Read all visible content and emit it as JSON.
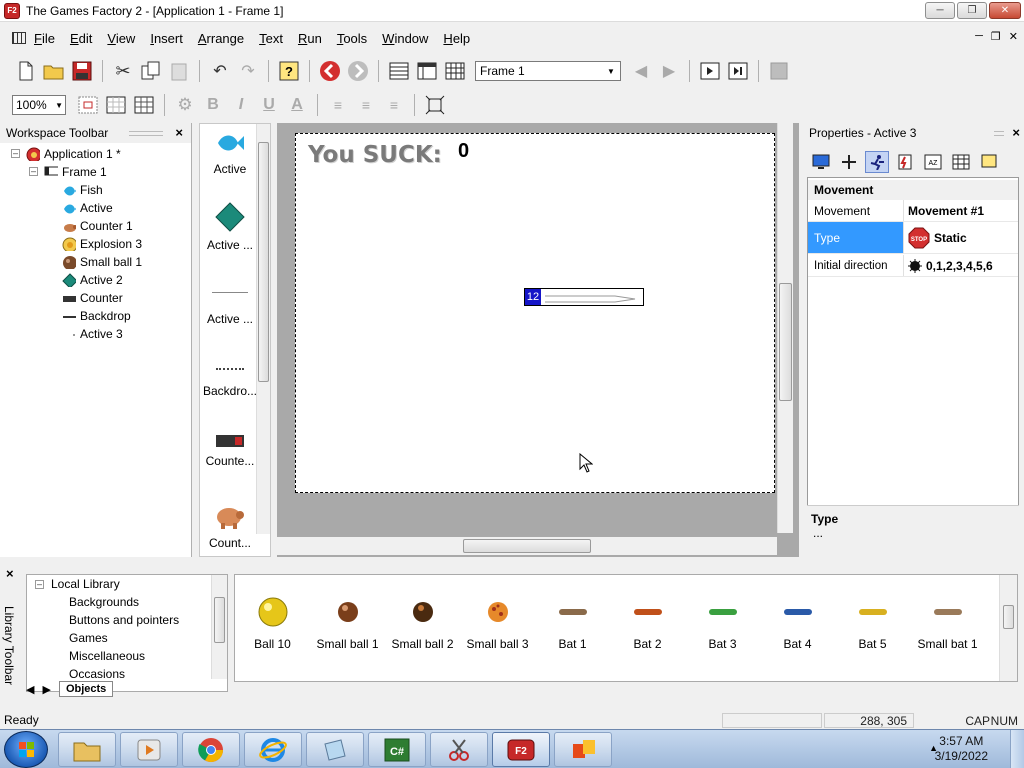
{
  "window": {
    "title": "The Games Factory 2 - [Application 1 - Frame 1]",
    "min_icon": "minimize-icon",
    "max_icon": "maximize-icon",
    "close_icon": "close-icon"
  },
  "menu": {
    "items": [
      {
        "label": "File",
        "underline": "F"
      },
      {
        "label": "Edit",
        "underline": "E"
      },
      {
        "label": "View",
        "underline": "V"
      },
      {
        "label": "Insert",
        "underline": "I"
      },
      {
        "label": "Arrange",
        "underline": "A"
      },
      {
        "label": "Text",
        "underline": "T"
      },
      {
        "label": "Run",
        "underline": "R"
      },
      {
        "label": "Tools",
        "underline": "T"
      },
      {
        "label": "Window",
        "underline": "W"
      },
      {
        "label": "Help",
        "underline": "H"
      }
    ]
  },
  "toolbar": {
    "frame_select": "Frame 1",
    "zoom_select": "100%"
  },
  "workspace": {
    "title": "Workspace Toolbar",
    "tree": {
      "app": "Application 1 *",
      "frame": "Frame 1",
      "objects": [
        "Fish",
        "Active",
        "Counter 1",
        "Explosion 3",
        "Small ball 1",
        "Active 2",
        "Counter",
        "Backdrop",
        "Active 3"
      ]
    }
  },
  "shelf": {
    "items": [
      "Active",
      "Active ...",
      "Active ...",
      "Backdro...",
      "Counte...",
      "Count..."
    ]
  },
  "frame": {
    "text_label": "You SUCK:",
    "counter_value": "0",
    "selected_object_number": "12"
  },
  "properties": {
    "title": "Properties - Active 3",
    "category": "Movement",
    "rows": [
      {
        "key": "Movement",
        "value": "Movement #1"
      },
      {
        "key": "Type",
        "value": "Static"
      },
      {
        "key": "Initial direction",
        "value": "0,1,2,3,4,5,6"
      }
    ],
    "help_title": "Type",
    "help_text": "..."
  },
  "library": {
    "side_label": "Library Toolbar",
    "tree": {
      "root": "Local Library",
      "children": [
        "Backgrounds",
        "Buttons and pointers",
        "Games",
        "Miscellaneous",
        "Occasions"
      ]
    },
    "tab": "Objects",
    "objects": [
      "Ball 10",
      "Small ball 1",
      "Small ball 2",
      "Small ball 3",
      "Bat 1",
      "Bat 2",
      "Bat 3",
      "Bat 4",
      "Bat 5",
      "Small bat 1"
    ]
  },
  "status": {
    "text": "Ready",
    "coords": "288, 305",
    "cap": "CAP",
    "num": "NUM"
  },
  "taskbar": {
    "time": "3:57 AM",
    "date": "3/19/2022"
  }
}
